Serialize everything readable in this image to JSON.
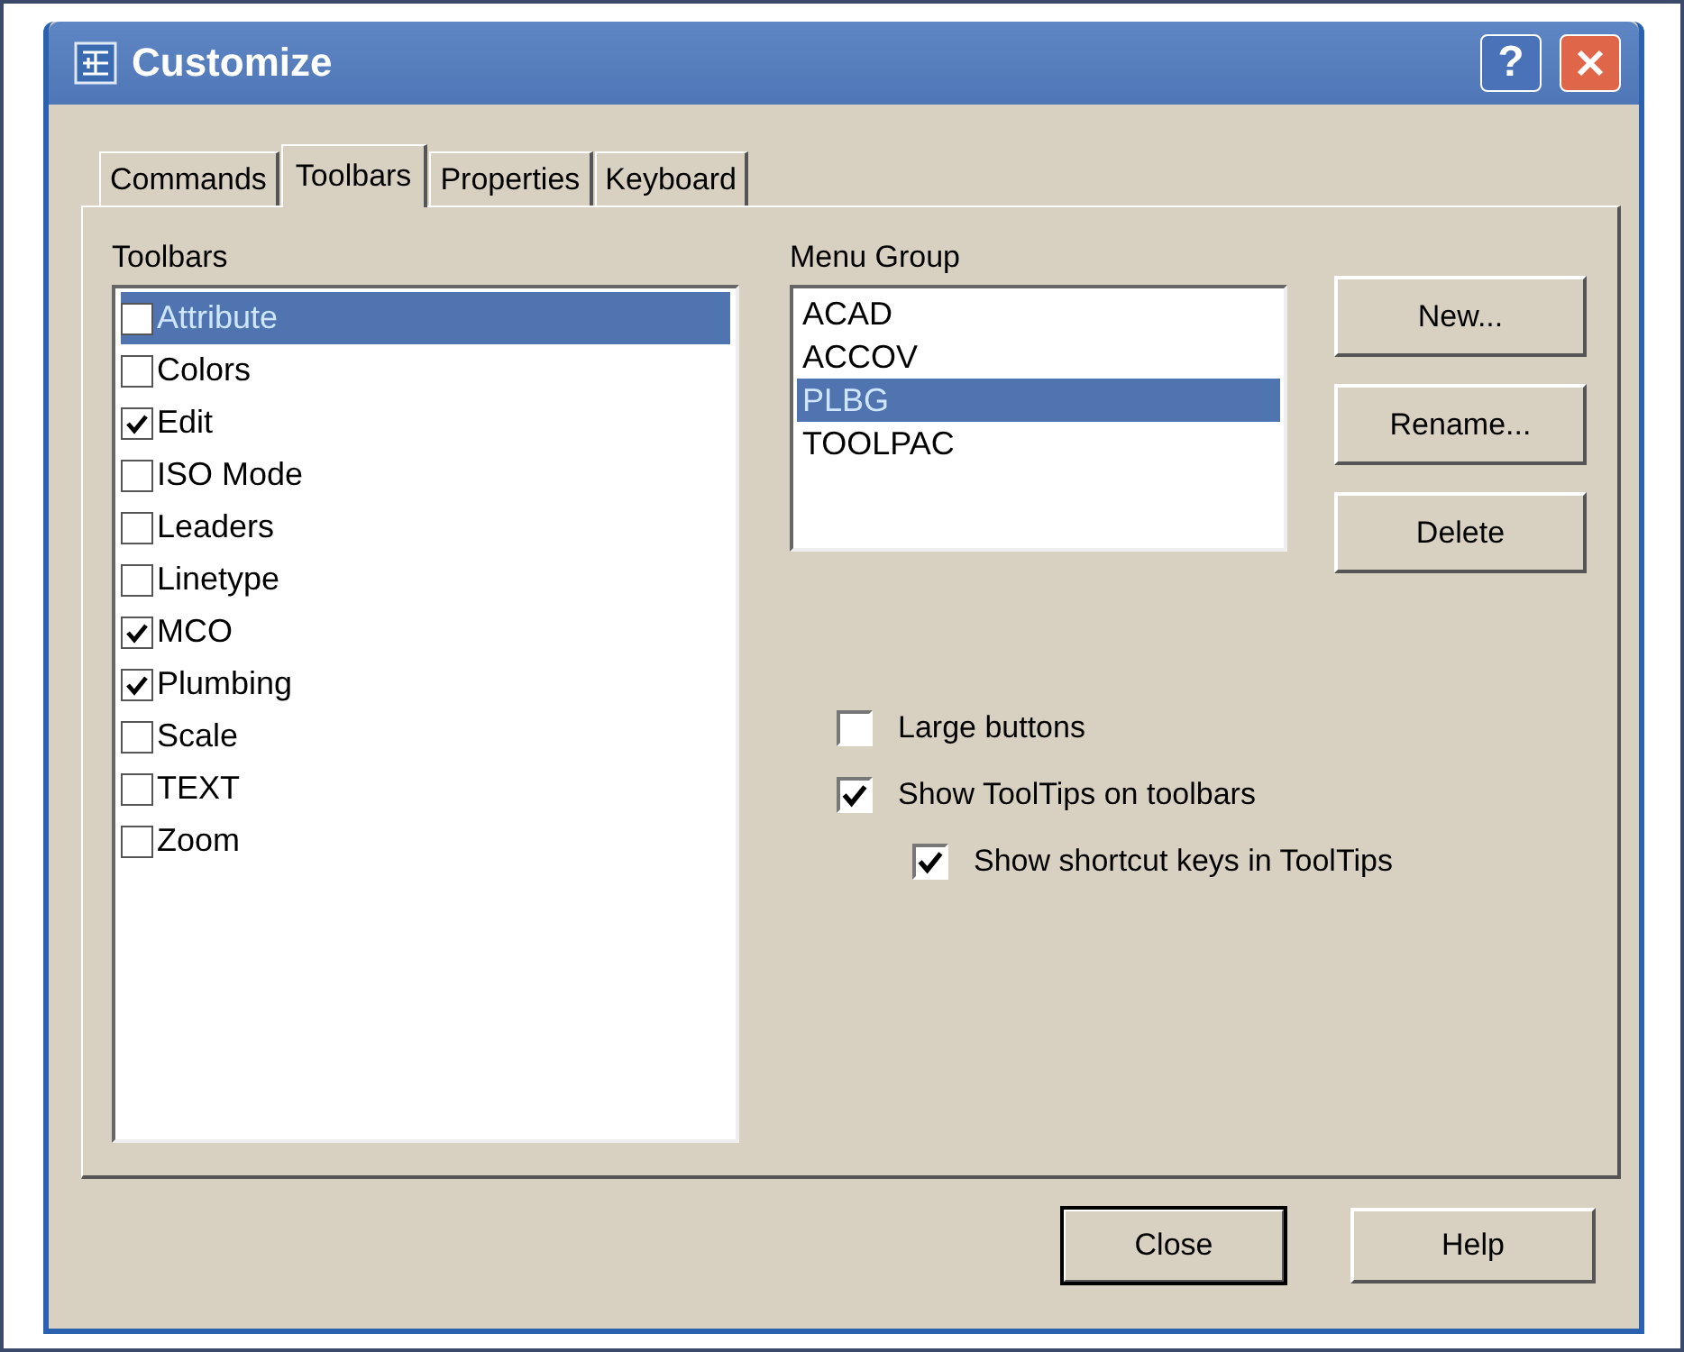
{
  "window": {
    "title": "Customize",
    "help_glyph": "?"
  },
  "tabs": [
    {
      "label": "Commands",
      "selected": false
    },
    {
      "label": "Toolbars",
      "selected": true
    },
    {
      "label": "Properties",
      "selected": false
    },
    {
      "label": "Keyboard",
      "selected": false
    }
  ],
  "toolbars": {
    "label": "Toolbars",
    "items": [
      {
        "label": "Attribute",
        "checked": false,
        "selected": true
      },
      {
        "label": "Colors",
        "checked": false,
        "selected": false
      },
      {
        "label": "Edit",
        "checked": true,
        "selected": false
      },
      {
        "label": "ISO Mode",
        "checked": false,
        "selected": false
      },
      {
        "label": "Leaders",
        "checked": false,
        "selected": false
      },
      {
        "label": "Linetype",
        "checked": false,
        "selected": false
      },
      {
        "label": "MCO",
        "checked": true,
        "selected": false
      },
      {
        "label": "Plumbing",
        "checked": true,
        "selected": false
      },
      {
        "label": "Scale",
        "checked": false,
        "selected": false
      },
      {
        "label": "TEXT",
        "checked": false,
        "selected": false
      },
      {
        "label": "Zoom",
        "checked": false,
        "selected": false
      }
    ]
  },
  "menu_group": {
    "label": "Menu Group",
    "items": [
      {
        "label": "ACAD",
        "selected": false
      },
      {
        "label": "ACCOV",
        "selected": false
      },
      {
        "label": "PLBG",
        "selected": true
      },
      {
        "label": "TOOLPAC",
        "selected": false
      }
    ]
  },
  "group_buttons": [
    "New...",
    "Rename...",
    "Delete"
  ],
  "options": [
    {
      "label": "Large buttons",
      "checked": false,
      "indented": false
    },
    {
      "label": "Show ToolTips on toolbars",
      "checked": true,
      "indented": false
    },
    {
      "label": "Show shortcut keys in ToolTips",
      "checked": true,
      "indented": true
    }
  ],
  "buttons": [
    {
      "label": "Close",
      "default": true
    },
    {
      "label": "Help",
      "default": false
    }
  ]
}
